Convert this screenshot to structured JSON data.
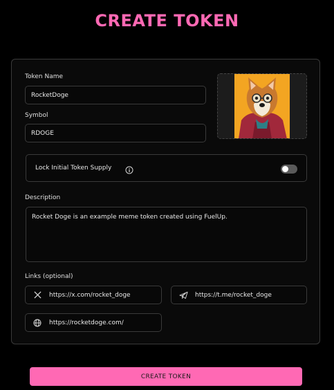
{
  "page": {
    "title": "CREATE TOKEN"
  },
  "form": {
    "token_name_label": "Token Name",
    "token_name_value": "RocketDoge",
    "symbol_label": "Symbol",
    "symbol_value": "RDOGE",
    "image_icon": "doge-with-glasses-image",
    "lock_label": "Lock Initial Token Supply",
    "lock_enabled": false,
    "description_label": "Description",
    "description_value": "Rocket Doge is an example meme token created using FuelUp.",
    "links_label": "Links (optional)",
    "links": [
      {
        "icon": "x-logo-icon",
        "value": "https://x.com/rocket_doge"
      },
      {
        "icon": "telegram-icon",
        "value": "https://t.me/rocket_doge"
      },
      {
        "icon": "globe-icon",
        "value": "https://rocketdoge.com/"
      }
    ]
  },
  "actions": {
    "create_label": "CREATE TOKEN"
  },
  "colors": {
    "accent": "#ff69b4",
    "background": "#000000",
    "border": "#3a3a3a"
  }
}
